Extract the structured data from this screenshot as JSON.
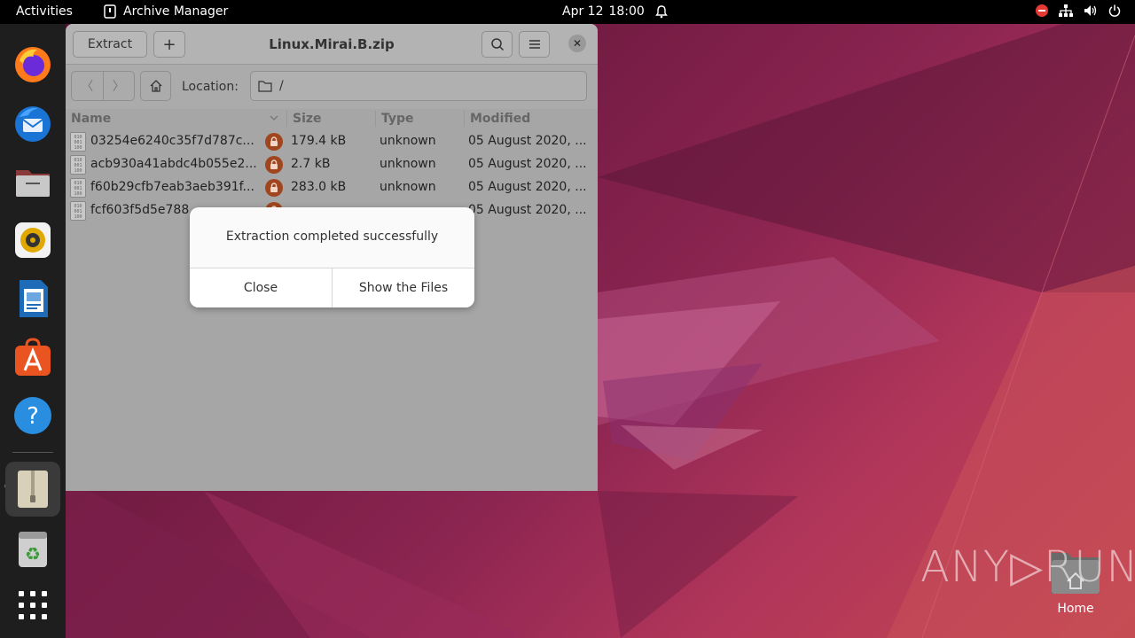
{
  "topbar": {
    "activities": "Activities",
    "app_name": "Archive Manager",
    "date": "Apr 12",
    "time": "18:00"
  },
  "dock": {
    "items": [
      "firefox-icon",
      "thunderbird-icon",
      "files-icon",
      "rhythmbox-icon",
      "writer-icon",
      "app-center-icon",
      "help-icon",
      "archive-manager-icon",
      "trash-icon",
      "show-apps-icon"
    ]
  },
  "window": {
    "title": "Linux.Mirai.B.zip",
    "extract_label": "Extract",
    "add_label": "+",
    "location_label": "Location:",
    "location_value": "/",
    "columns": {
      "name": "Name",
      "size": "Size",
      "type": "Type",
      "modified": "Modified"
    },
    "files": [
      {
        "name": "03254e6240c35f7d787c...",
        "size": "179.4 kB",
        "type": "unknown",
        "modified": "05 August 2020, ..."
      },
      {
        "name": "acb930a41abdc4b055e2...",
        "size": "2.7 kB",
        "type": "unknown",
        "modified": "05 August 2020, ..."
      },
      {
        "name": "f60b29cfb7eab3aeb391f...",
        "size": "283.0 kB",
        "type": "unknown",
        "modified": "05 August 2020, ..."
      },
      {
        "name": "fcf603f5d5e788",
        "size": "",
        "type": "",
        "modified": "05 August 2020, ..."
      }
    ]
  },
  "dialog": {
    "message": "Extraction completed successfully",
    "close_label": "Close",
    "show_files_label": "Show the Files"
  },
  "desktop": {
    "home_label": "Home",
    "watermark": "ANY▷RUN"
  },
  "colors": {
    "dock_bg": "#1e1e1e",
    "topbar_bg": "#000000",
    "accent": "#e95420",
    "lock_badge": "#a0461f"
  }
}
